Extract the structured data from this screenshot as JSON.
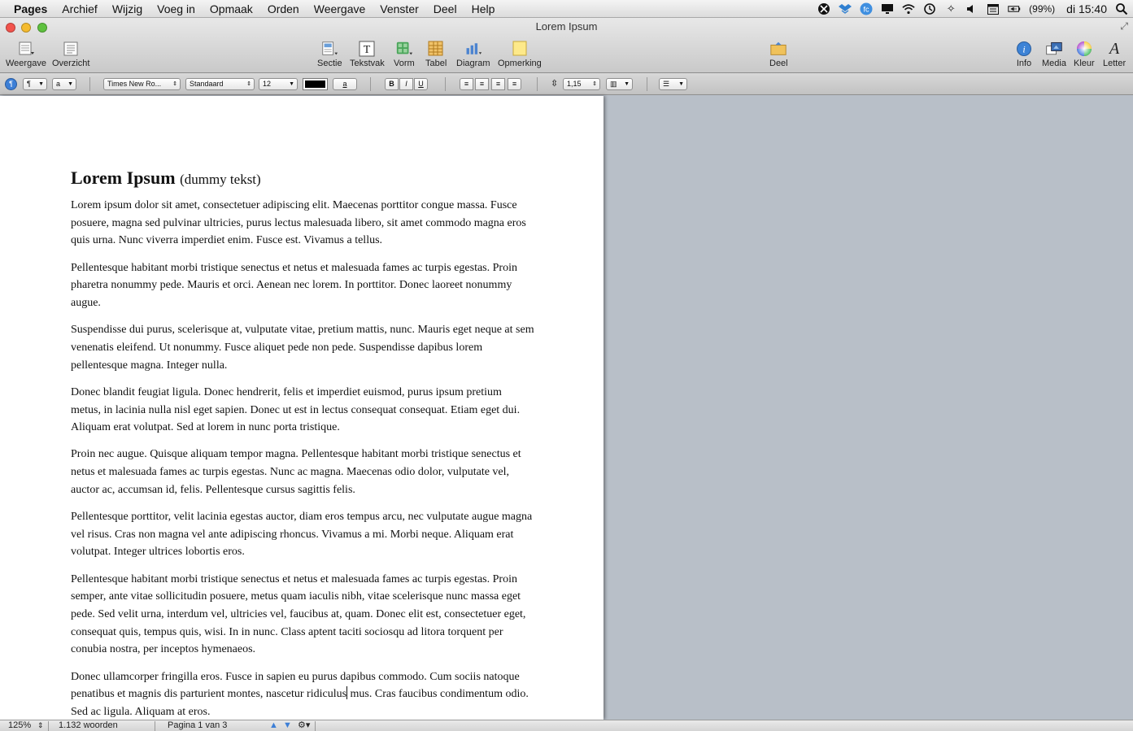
{
  "menubar": {
    "items": [
      "Pages",
      "Archief",
      "Wijzig",
      "Voeg in",
      "Opmaak",
      "Orden",
      "Weergave",
      "Venster",
      "Deel",
      "Help"
    ],
    "battery": "(99%)",
    "clock": "di 15:40"
  },
  "window": {
    "title": "Lorem Ipsum"
  },
  "toolbar": {
    "weergave": "Weergave",
    "overzicht": "Overzicht",
    "sectie": "Sectie",
    "tekstvak": "Tekstvak",
    "vorm": "Vorm",
    "tabel": "Tabel",
    "diagram": "Diagram",
    "opmerking": "Opmerking",
    "deel": "Deel",
    "info": "Info",
    "media": "Media",
    "kleur": "Kleur",
    "letter": "Letter"
  },
  "formatbar": {
    "paragraph_style": "¶",
    "char_style": "a",
    "font_family": "Times New Ro...",
    "font_typeface": "Standaard",
    "font_size": "12",
    "text_color": "#000000",
    "highlight_label": "a",
    "bold": "B",
    "italic": "I",
    "underline": "U",
    "line_spacing": "1,15"
  },
  "document": {
    "title": "Lorem Ipsum",
    "subtitle": "(dummy tekst)",
    "paragraphs": [
      "Lorem ipsum dolor sit amet, consectetuer adipiscing elit. Maecenas porttitor congue massa. Fusce posuere, magna sed pulvinar ultricies, purus lectus malesuada libero, sit amet commodo magna eros quis urna. Nunc viverra imperdiet enim. Fusce est. Vivamus a tellus.",
      "Pellentesque habitant morbi tristique senectus et netus et malesuada fames ac turpis egestas. Proin pharetra nonummy pede. Mauris et orci. Aenean nec lorem. In porttitor. Donec laoreet nonummy augue.",
      "Suspendisse dui purus, scelerisque at, vulputate vitae, pretium mattis, nunc. Mauris eget neque at sem venenatis eleifend. Ut nonummy. Fusce aliquet pede non pede. Suspendisse dapibus lorem pellentesque magna. Integer nulla.",
      "Donec blandit feugiat ligula. Donec hendrerit, felis et imperdiet euismod, purus ipsum pretium metus, in lacinia nulla nisl eget sapien. Donec ut est in lectus consequat consequat. Etiam eget dui. Aliquam erat volutpat. Sed at lorem in nunc porta tristique.",
      "Proin nec augue. Quisque aliquam tempor magna. Pellentesque habitant morbi tristique senectus et netus et malesuada fames ac turpis egestas. Nunc ac magna. Maecenas odio dolor, vulputate vel, auctor ac, accumsan id, felis. Pellentesque cursus sagittis felis.",
      "Pellentesque porttitor, velit lacinia egestas auctor, diam eros tempus arcu, nec vulputate augue magna vel risus. Cras non magna vel ante adipiscing rhoncus. Vivamus a mi. Morbi neque. Aliquam erat volutpat. Integer ultrices lobortis eros.",
      "Pellentesque habitant morbi tristique senectus et netus et malesuada fames ac turpis egestas. Proin semper, ante vitae sollicitudin posuere, metus quam iaculis nibh, vitae scelerisque nunc massa eget pede. Sed velit urna, interdum vel, ultricies vel, faucibus at, quam. Donec elit est, consectetuer eget, consequat quis, tempus quis, wisi. In in nunc. Class aptent taciti sociosqu ad litora torquent per conubia nostra, per inceptos hymenaeos."
    ],
    "last_paragraph_before_caret": "Donec ullamcorper fringilla eros. Fusce in sapien eu purus dapibus commodo. Cum sociis natoque penatibus et magnis dis parturient montes, nascetur ridiculus",
    "last_paragraph_after_caret": " mus. Cras faucibus condimentum odio. Sed ac ligula. Aliquam at eros."
  },
  "statusbar": {
    "zoom": "125%",
    "word_count": "1.132 woorden",
    "page_info": "Pagina 1 van 3"
  },
  "colors": {
    "canvas_background": "#b8bfc8",
    "traffic_close": "#f2534c",
    "traffic_minimize": "#f5bb2f",
    "traffic_zoom": "#5ec13e"
  },
  "icons": {
    "status": [
      "smartsleep-icon",
      "dropbox-icon",
      "sync-icon",
      "display-icon",
      "wifi-icon",
      "timemachine-icon",
      "bluetooth-icon",
      "volume-icon",
      "calendar-icon",
      "battery-icon",
      "spotlight-icon"
    ]
  }
}
